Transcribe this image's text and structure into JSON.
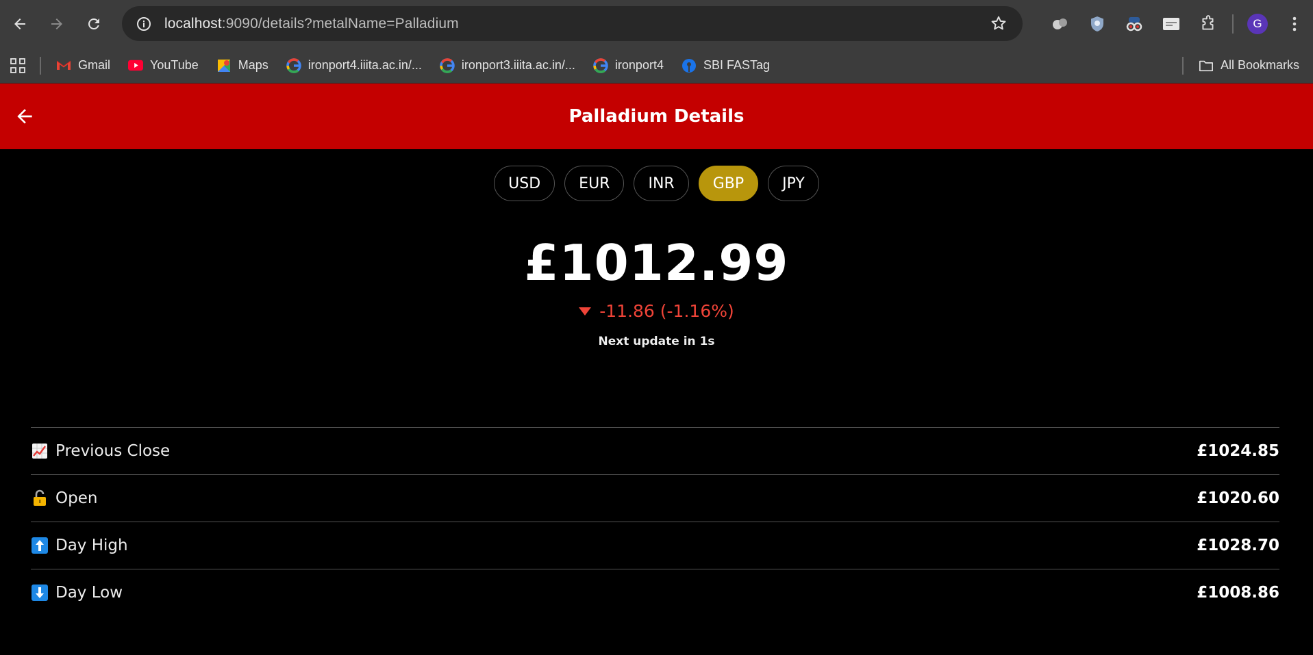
{
  "browser": {
    "url_host": "localhost",
    "url_rest": ":9090/details?metalName=Palladium",
    "profile_initial": "G",
    "bookmarks": [
      {
        "label": "Gmail",
        "icon": "gmail-icon"
      },
      {
        "label": "YouTube",
        "icon": "youtube-icon"
      },
      {
        "label": "Maps",
        "icon": "maps-icon"
      },
      {
        "label": "ironport4.iiita.ac.in/...",
        "icon": "google-icon"
      },
      {
        "label": "ironport3.iiita.ac.in/...",
        "icon": "google-icon"
      },
      {
        "label": "ironport4",
        "icon": "google-icon"
      },
      {
        "label": "SBI FASTag",
        "icon": "sbi-icon"
      }
    ],
    "all_bookmarks": "All Bookmarks"
  },
  "header": {
    "title": "Palladium Details",
    "color": "#c40000"
  },
  "currencies": {
    "options": [
      "USD",
      "EUR",
      "INR",
      "GBP",
      "JPY"
    ],
    "selected": "GBP",
    "selected_color": "#b8960c"
  },
  "price": {
    "value": "£1012.99",
    "change": "-11.86 (-1.16%)",
    "change_color": "#f04438",
    "direction": "down",
    "next_update": "Next update in 1s"
  },
  "stats": [
    {
      "icon": "chart-increasing-icon",
      "emoji": "📈",
      "label": "Previous Close",
      "value": "£1024.85"
    },
    {
      "icon": "unlocked-icon",
      "emoji": "🔓",
      "label": "Open",
      "value": "£1020.60"
    },
    {
      "icon": "up-arrow-icon",
      "emoji": "⬆",
      "label": "Day High",
      "value": "£1028.70"
    },
    {
      "icon": "down-arrow-icon",
      "emoji": "⬇",
      "label": "Day Low",
      "value": "£1008.86"
    }
  ]
}
